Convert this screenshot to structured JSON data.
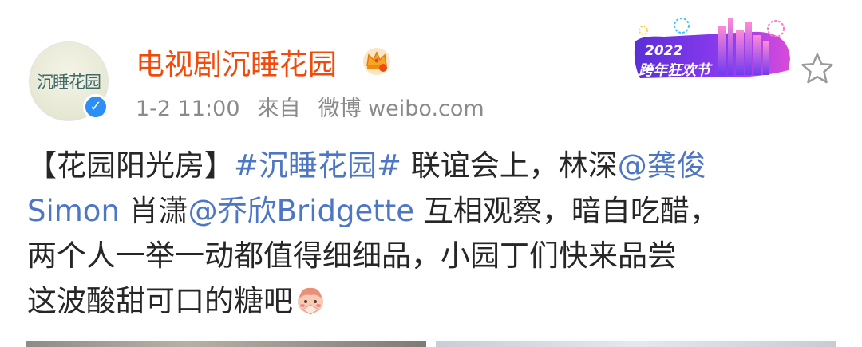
{
  "post": {
    "author": {
      "name": "电视剧沉睡花园",
      "avatar_text": "沉睡花园",
      "verified_glyph": "✓",
      "badge_icon": "crown-icon"
    },
    "timestamp": "1-2 11:00",
    "source_label": "來自",
    "source_name": "微博 weibo.com",
    "banner": {
      "year": "2022",
      "title": "跨年狂欢节"
    },
    "content": {
      "line1": {
        "prefix": "【花园阳光房】",
        "hashtag": "#沉睡花园#",
        "middle": " 联谊会上，林深",
        "mention1_start": "@龚俊"
      },
      "line2": {
        "mention1_end": "Simon",
        "middle": " 肖潇",
        "mention2": "@乔欣Bridgette",
        "tail": " 互相观察，暗自吃醋，"
      },
      "line3": "两个人一举一动都值得细细品，小园丁们快来品尝",
      "line4": {
        "text": "这波酸甜可口的糖吧",
        "emoji": "bashful-emoji"
      }
    }
  },
  "colors": {
    "username": "#f04a0c",
    "link": "#4d77c4",
    "body_text": "#262626",
    "meta_text": "#8a8a8a",
    "verified": "#2b8ff6"
  },
  "icons": {
    "favorite": "star-outline-icon"
  }
}
